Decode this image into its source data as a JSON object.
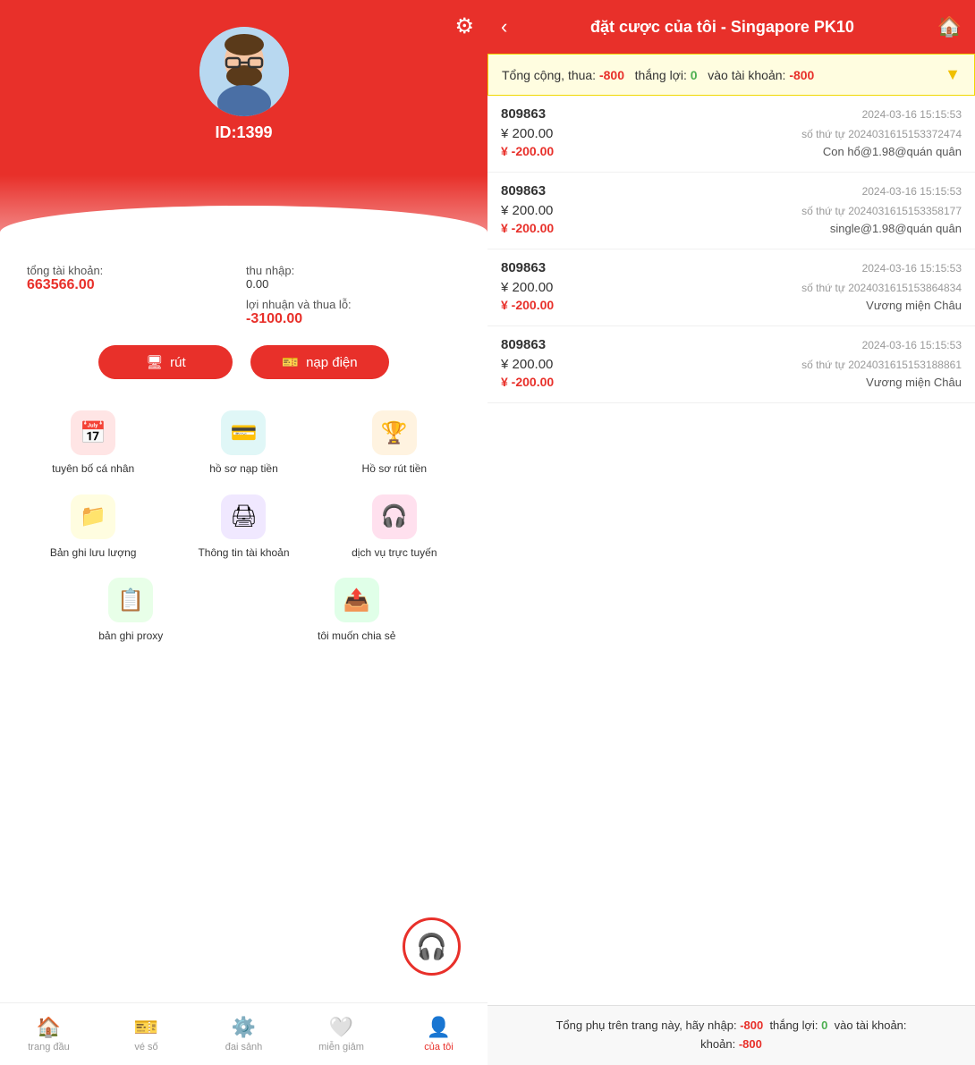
{
  "left": {
    "userId": "ID:1399",
    "totalAccount": "663566.00",
    "income": "0.00",
    "profitLoss": "-3100.00",
    "totalAccountLabel": "tổng tài khoản:",
    "incomeLabel": "thu nhập:",
    "profitLossLabel": "lợi nhuận và thua lỗ:",
    "withdrawBtn": "rút",
    "depositBtn": "nạp điện",
    "menuItems": [
      {
        "id": "tuyen-bo-ca-nhan",
        "label": "tuyên bố cá nhân",
        "icon": "📅",
        "iconClass": "icon-red"
      },
      {
        "id": "ho-so-nap-tien",
        "label": "hồ sơ nạp tiền",
        "icon": "💳",
        "iconClass": "icon-teal"
      },
      {
        "id": "ho-so-rut-tien",
        "label": "Hồ sơ rút tiền",
        "icon": "🏆",
        "iconClass": "icon-orange"
      },
      {
        "id": "ban-ghi-luu-luong",
        "label": "Bản ghi lưu lượng",
        "icon": "📁",
        "iconClass": "icon-yellow"
      },
      {
        "id": "thong-tin-tai-khoan",
        "label": "Thông tin tài khoản",
        "icon": "🖨",
        "iconClass": "icon-purple"
      },
      {
        "id": "dich-vu-truc-tuyen",
        "label": "dịch vụ trực tuyến",
        "icon": "🎧",
        "iconClass": "icon-pink"
      },
      {
        "id": "ban-ghi-proxy",
        "label": "bản ghi proxy",
        "icon": "📋",
        "iconClass": "icon-green"
      },
      {
        "id": "toi-muon-chia-se",
        "label": "tôi muốn chia sẻ",
        "icon": "📤",
        "iconClass": "icon-green2"
      }
    ],
    "nav": [
      {
        "id": "trang-dau",
        "label": "trang đầu",
        "icon": "🏠",
        "active": false
      },
      {
        "id": "ve-so",
        "label": "vé số",
        "icon": "🎫",
        "active": false
      },
      {
        "id": "dai-sanh",
        "label": "đai sảnh",
        "icon": "⚙️",
        "active": false
      },
      {
        "id": "mien-giam",
        "label": "miễn giảm",
        "icon": "❤️",
        "active": false
      },
      {
        "id": "cua-toi",
        "label": "của tôi",
        "icon": "👤",
        "active": true
      }
    ]
  },
  "right": {
    "title": "đặt cược của tôi - Singapore PK10",
    "summary": {
      "label1": "Tổng cộng, thua:",
      "value1": "-800",
      "label2": "thắng lợi:",
      "value2": "0",
      "label3": "vào tài khoản:",
      "value3": "-800"
    },
    "bets": [
      {
        "id": "809863",
        "time": "2024-03-16 15:15:53",
        "amount": "¥ 200.00",
        "ref": "số thứ tự 2024031615153372474",
        "result": "¥ -200.00",
        "desc": "Con hổ@1.98@quán quân"
      },
      {
        "id": "809863",
        "time": "2024-03-16 15:15:53",
        "amount": "¥ 200.00",
        "ref": "số thứ tự 2024031615153358177",
        "result": "¥ -200.00",
        "desc": "single@1.98@quán quân"
      },
      {
        "id": "809863",
        "time": "2024-03-16 15:15:53",
        "amount": "¥ 200.00",
        "ref": "số thứ tự 2024031615153864834",
        "result": "¥ -200.00",
        "desc": "Vương miện Châu"
      },
      {
        "id": "809863",
        "time": "2024-03-16 15:15:53",
        "amount": "¥ 200.00",
        "ref": "số thứ tự 2024031615153188861",
        "result": "¥ -200.00",
        "desc": "Vương miện Châu"
      }
    ],
    "bottomSummary": {
      "prefix": "Tổng phụ trên trang này, hãy nhập:",
      "value1": "-800",
      "label2": "thắng lợi:",
      "value2": "0",
      "label3": "vào tài khoản:",
      "value3": "-800"
    }
  }
}
